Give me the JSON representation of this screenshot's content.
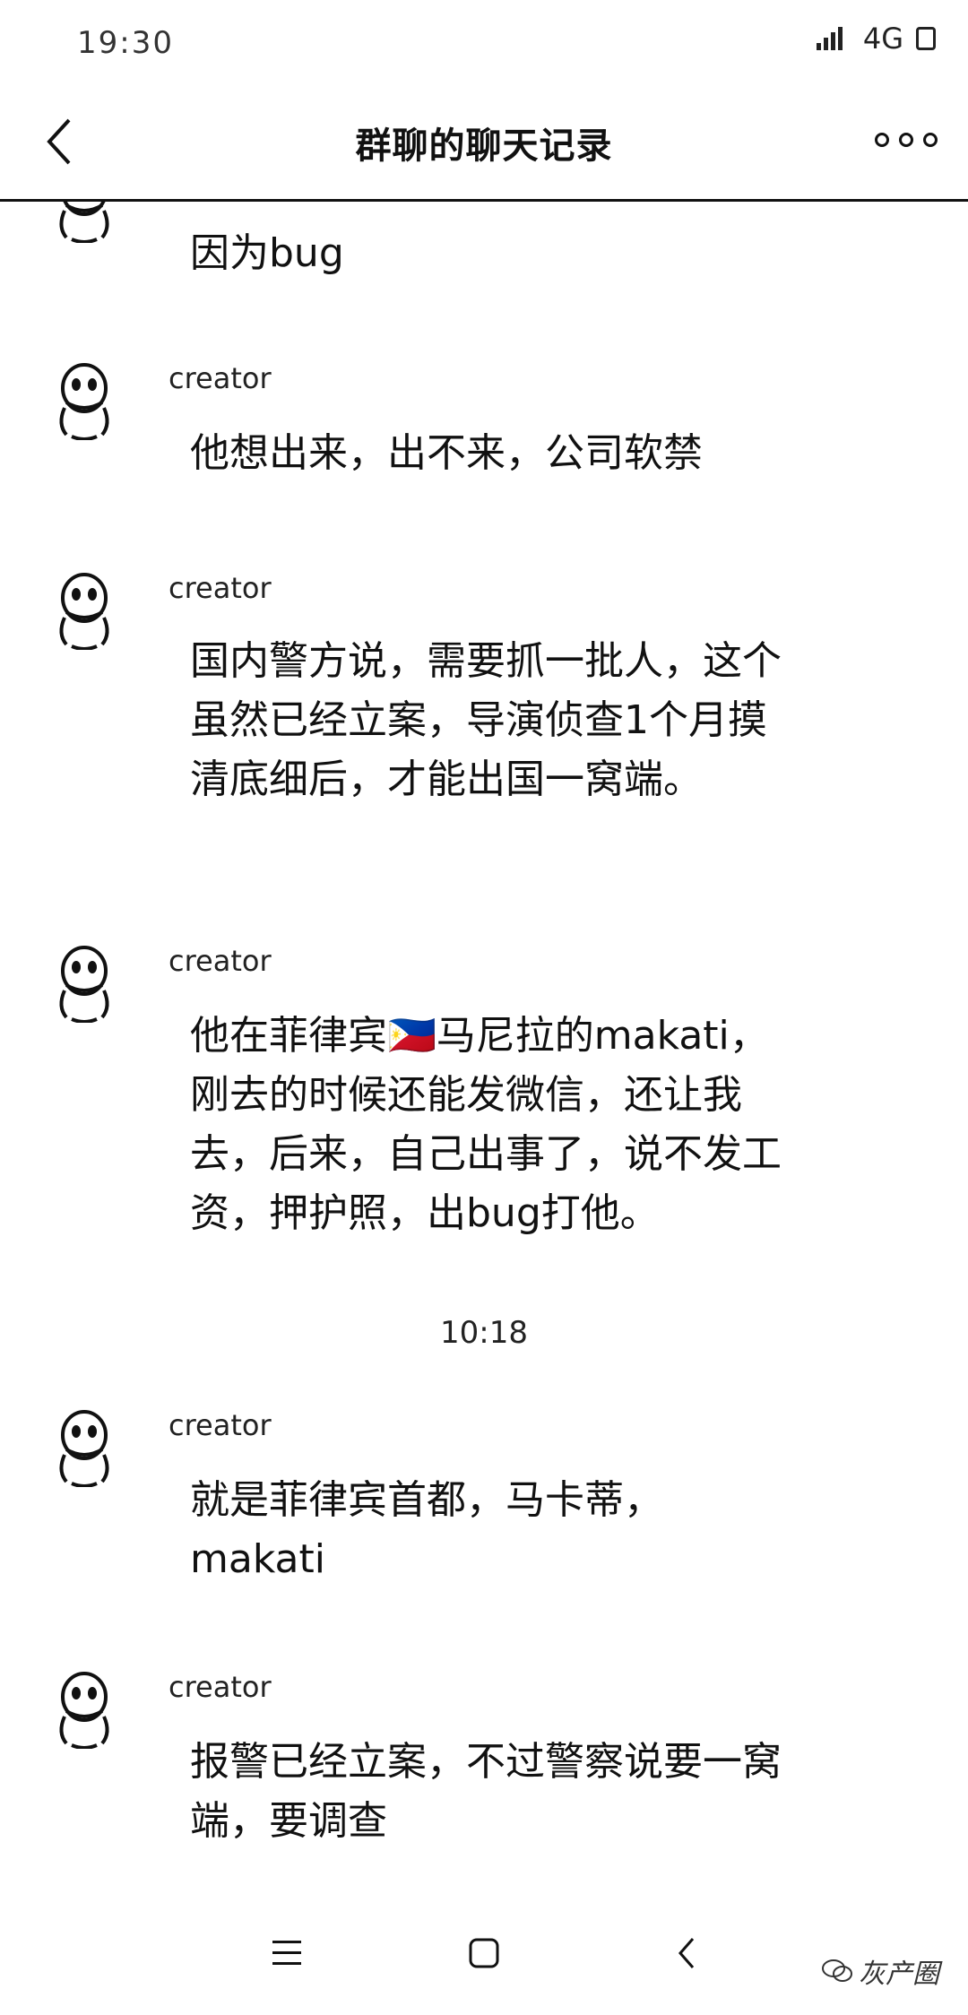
{
  "status_bar": {
    "time": "19:30",
    "network": "4G",
    "signal_icon": "signal-bars-icon",
    "battery_icon": "battery-icon"
  },
  "header": {
    "title": "群聊的聊天记录",
    "back_icon": "chevron-left-icon",
    "more_icon": "more-icon"
  },
  "messages": [
    {
      "sender": "",
      "text": "因为bug"
    },
    {
      "sender": "creator",
      "text": "他想出来，出不来，公司软禁"
    },
    {
      "sender": "creator",
      "text": "国内警方说，需要抓一批人，这个虽然已经立案，导演侦查1个月摸清底细后，才能出国一窝端。"
    },
    {
      "sender": "creator",
      "text": "他在菲律宾🇵🇭马尼拉的makati，刚去的时候还能发微信，还让我去，后来，自己出事了，说不发工资，押护照，出bug打他。"
    },
    {
      "sender": "creator",
      "text": "就是菲律宾首都，马卡蒂，makati"
    },
    {
      "sender": "creator",
      "text": "报警已经立案，不过警察说要一窝端，要调查"
    }
  ],
  "time_divider": "10:18",
  "nav": {
    "menu_icon": "menu-icon",
    "home_icon": "home-icon",
    "back_icon": "back-icon"
  },
  "watermark": "灰产圈"
}
